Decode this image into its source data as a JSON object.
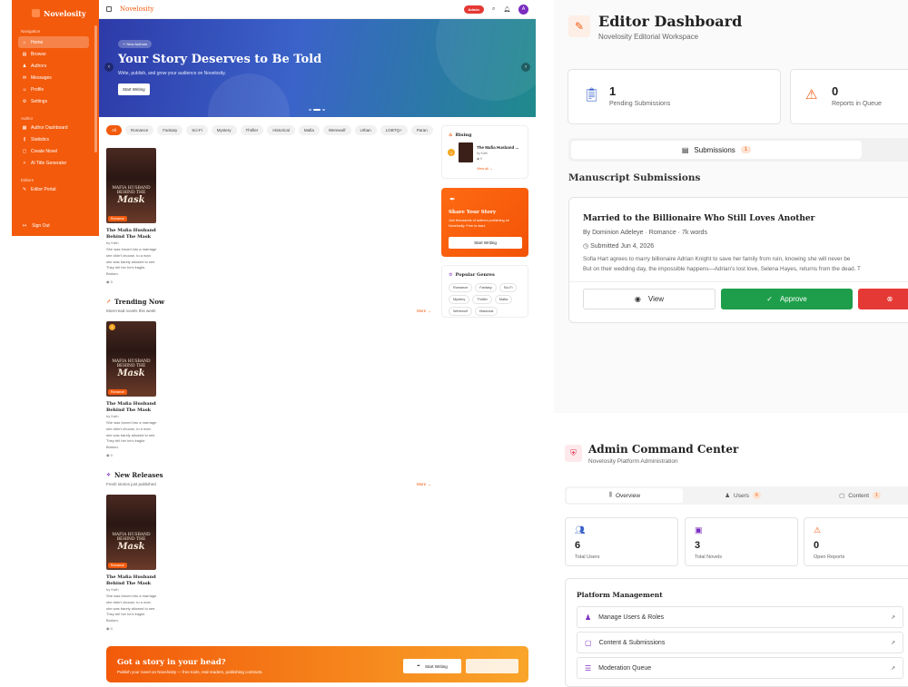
{
  "sidebar": {
    "brand": "Novelosity",
    "nav_label": "Navigation",
    "nav": [
      {
        "label": "Home",
        "icon": "⌂"
      },
      {
        "label": "Browse",
        "icon": "▤"
      },
      {
        "label": "Authors",
        "icon": "♟"
      },
      {
        "label": "Messages",
        "icon": "✉"
      },
      {
        "label": "Profile",
        "icon": "☺"
      },
      {
        "label": "Settings",
        "icon": "⚙"
      }
    ],
    "author_label": "Author",
    "author": [
      {
        "label": "Author Dashboard",
        "icon": "▦"
      },
      {
        "label": "Statistics",
        "icon": "⫼"
      },
      {
        "label": "Create Novel",
        "icon": "▢"
      },
      {
        "label": "AI Title Generator",
        "icon": "✧"
      }
    ],
    "editors_label": "Editors",
    "editors": [
      {
        "label": "Editor Portal",
        "icon": "✎"
      }
    ],
    "signout": "Sign Out"
  },
  "topbar": {
    "brand": "Novelosity",
    "admin_badge": "Admin",
    "avatar": "A"
  },
  "hero": {
    "badge": "✧ New Authors",
    "title": "Your Story Deserves to Be Told",
    "subtitle": "Write, publish, and grow your audience on Novelosity.",
    "button": "Start Writing"
  },
  "genres": [
    "All",
    "Romance",
    "Fantasy",
    "Sci-Fi",
    "Mystery",
    "Thriller",
    "Historical",
    "Mafia",
    "Werewolf",
    "Urban",
    "LGBTQ+",
    "Paran"
  ],
  "book": {
    "cover_line1": "MAFIA HUSBAND",
    "cover_line2": "BEHIND THE",
    "cover_line3": "Mask",
    "tag": "Romance",
    "title": "The Mafia Husband Behind The Mask",
    "author": "by Kath",
    "desc": "She was forced into a marriage she didn't choose, to a man she was barely allowed to see. They tell her he's fragile. Broken.",
    "views": "◉ 0",
    "rank": "1"
  },
  "sections": {
    "trending_title": "Trending Now",
    "trending_sub": "Most-read novels this week",
    "new_title": "New Releases",
    "new_sub": "Fresh stories just published",
    "more": "More →"
  },
  "rising": {
    "title": "Rising",
    "item_title": "The Mafia Husband ...",
    "item_author": "by Kath",
    "item_views": "◉ 0",
    "rank": "1",
    "view_all": "View all →"
  },
  "share": {
    "title": "Share Your Story",
    "desc": "Join thousands of authors publishing on Novelosity. Free to start.",
    "button": "Start Writing"
  },
  "popular_genres": {
    "title": "Popular Genres",
    "items": [
      "Romance",
      "Fantasy",
      "Sci-Fi",
      "Mystery",
      "Thriller",
      "Mafia",
      "Werewolf",
      "Historical"
    ]
  },
  "cta": {
    "title": "Got a story in your head?",
    "subtitle": "Publish your novel on Novelosity — free tools, real readers, publishing contracts.",
    "button": "Start Writing"
  },
  "editor": {
    "title": "Editor Dashboard",
    "subtitle": "Novelosity Editorial Workspace",
    "stats": [
      {
        "value": "1",
        "label": "Pending Submissions"
      },
      {
        "value": "0",
        "label": "Reports in Queue"
      }
    ],
    "tab": "Submissions",
    "tab_count": "1",
    "section": "Manuscript Submissions",
    "manuscript": {
      "title": "Married to the Billionaire Who Still Loves Another",
      "meta": "By Dominion Adeleye · Romance · 7k words",
      "date": "Submitted Jun 4, 2026",
      "excerpt1": "Sofia Hart agrees to marry billionaire Adrian Knight to save her family from ruin, knowing she will never be",
      "excerpt2": "But on their wedding day, the impossible happens—Adrian's lost love, Selena Hayes, returns from the dead. T"
    },
    "view": "View",
    "approve": "Approve"
  },
  "admin": {
    "title": "Admin Command Center",
    "subtitle": "Novelosity Platform Administration",
    "tabs": [
      {
        "label": "Overview",
        "icon": "⫼",
        "count": ""
      },
      {
        "label": "Users",
        "icon": "♟",
        "count": "6"
      },
      {
        "label": "Content",
        "icon": "▢",
        "count": "1"
      }
    ],
    "stats": [
      {
        "value": "6",
        "label": "Total Users"
      },
      {
        "value": "3",
        "label": "Total Novels"
      },
      {
        "value": "0",
        "label": "Open Reports"
      }
    ],
    "platform_title": "Platform Management",
    "platform": [
      "Manage Users & Roles",
      "Content & Submissions",
      "Moderation Queue"
    ]
  },
  "colors": {
    "brand": "#f35a0c",
    "approve": "#1e9e4a",
    "danger": "#e53935"
  }
}
